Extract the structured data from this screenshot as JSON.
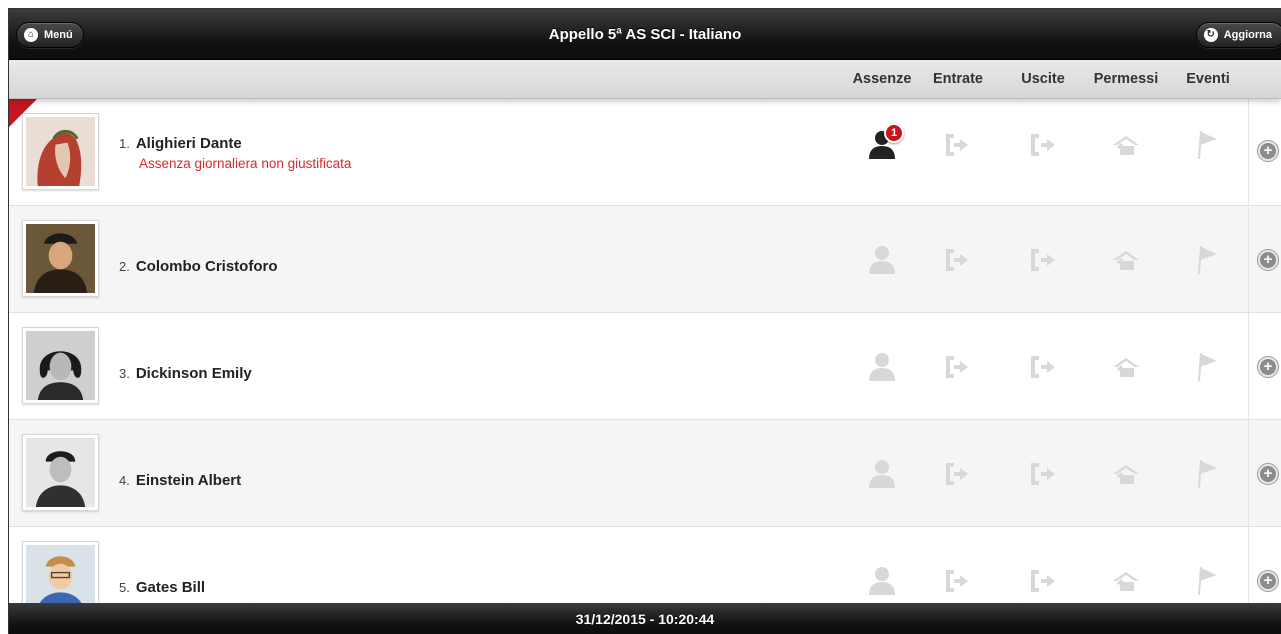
{
  "header": {
    "title": "Appello 5ª AS SCI - Italiano",
    "menu_label": "Menú",
    "refresh_label": "Aggiorna"
  },
  "columns": [
    "Assenze",
    "Entrate",
    "Uscite",
    "Permessi",
    "Eventi"
  ],
  "students": [
    {
      "num": "1.",
      "name": "Alighieri Dante",
      "note": "Assenza giornaliera non giustificata",
      "absent": true,
      "absence_count": "1",
      "photo": "portrait-dante"
    },
    {
      "num": "2.",
      "name": "Colombo Cristoforo",
      "note": "",
      "absent": false,
      "absence_count": "",
      "photo": "portrait-columbus"
    },
    {
      "num": "3.",
      "name": "Dickinson Emily",
      "note": "",
      "absent": false,
      "absence_count": "",
      "photo": "portrait-dickinson"
    },
    {
      "num": "4.",
      "name": "Einstein Albert",
      "note": "",
      "absent": false,
      "absence_count": "",
      "photo": "portrait-einstein"
    },
    {
      "num": "5.",
      "name": "Gates Bill",
      "note": "",
      "absent": false,
      "absence_count": "",
      "photo": "portrait-gates"
    }
  ],
  "footer": {
    "datetime": "31/12/2015 - 10:20:44"
  },
  "colors": {
    "accent_red": "#c4161c",
    "note_red": "#d42a2a",
    "icon_inactive": "#d8d8d8",
    "icon_active": "#222222",
    "bar_dark": "#111111"
  }
}
